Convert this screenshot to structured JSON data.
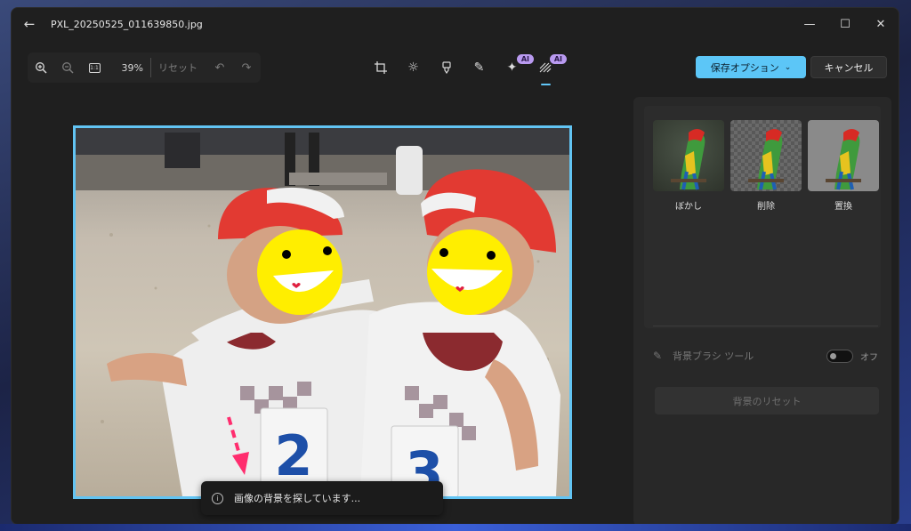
{
  "window": {
    "title": "PXL_20250525_011639850.jpg"
  },
  "icons": {
    "back": "arrow-left-icon",
    "minimize": "minimize-icon",
    "maximize": "maximize-icon",
    "close": "close-icon"
  },
  "toolbar": {
    "zoom_percent": "39%",
    "reset_label": "リセット",
    "fit_label": "1:1",
    "ai_badge": "AI",
    "save_options_label": "保存オプション",
    "cancel_label": "キャンセル"
  },
  "colors": {
    "accent": "#5cc6f7",
    "ai_badge": "#b99af0"
  },
  "background_panel": {
    "options": [
      {
        "label": "ぼかし"
      },
      {
        "label": "削除"
      },
      {
        "label": "置換"
      }
    ],
    "brush_tool_label": "背景ブラシ ツール",
    "toggle_state_label": "オフ",
    "reset_background_label": "背景のリセット"
  },
  "photo": {
    "jersey_numbers": [
      "2",
      "3"
    ]
  },
  "toast": {
    "message": "画像の背景を探しています..."
  }
}
